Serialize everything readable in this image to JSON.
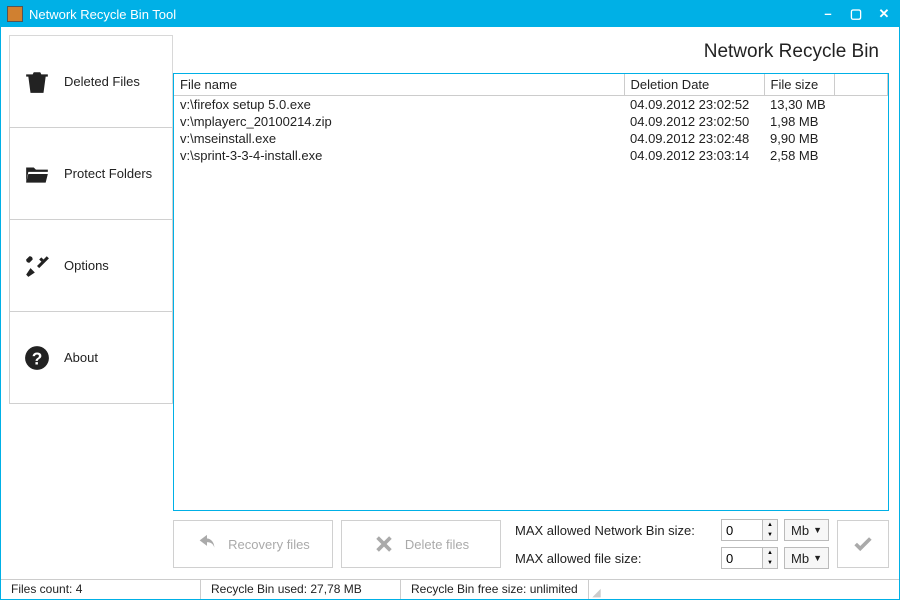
{
  "window": {
    "title": "Network Recycle Bin Tool"
  },
  "sidebar": {
    "items": [
      {
        "label": "Deleted Files"
      },
      {
        "label": "Protect Folders"
      },
      {
        "label": "Options"
      },
      {
        "label": "About"
      }
    ]
  },
  "pane": {
    "title": "Network Recycle Bin"
  },
  "table": {
    "headers": {
      "filename": "File name",
      "deletion": "Deletion Date",
      "size": "File size"
    },
    "rows": [
      {
        "name": "v:\\firefox setup 5.0.exe",
        "date": "04.09.2012 23:02:52",
        "size": "13,30 MB"
      },
      {
        "name": "v:\\mplayerc_20100214.zip",
        "date": "04.09.2012 23:02:50",
        "size": "1,98 MB"
      },
      {
        "name": "v:\\mseinstall.exe",
        "date": "04.09.2012 23:02:48",
        "size": "9,90 MB"
      },
      {
        "name": "v:\\sprint-3-3-4-install.exe",
        "date": "04.09.2012 23:03:14",
        "size": "2,58 MB"
      }
    ]
  },
  "controls": {
    "recovery": "Recovery files",
    "delete": "Delete files",
    "max_net_label": "MAX allowed Network Bin size:",
    "max_file_label": "MAX allowed file size:",
    "max_net_value": "0",
    "max_file_value": "0",
    "unit": "Mb"
  },
  "status": {
    "count": "Files count: 4",
    "used": "Recycle Bin used: 27,78 MB",
    "free": "Recycle Bin free size: unlimited"
  }
}
